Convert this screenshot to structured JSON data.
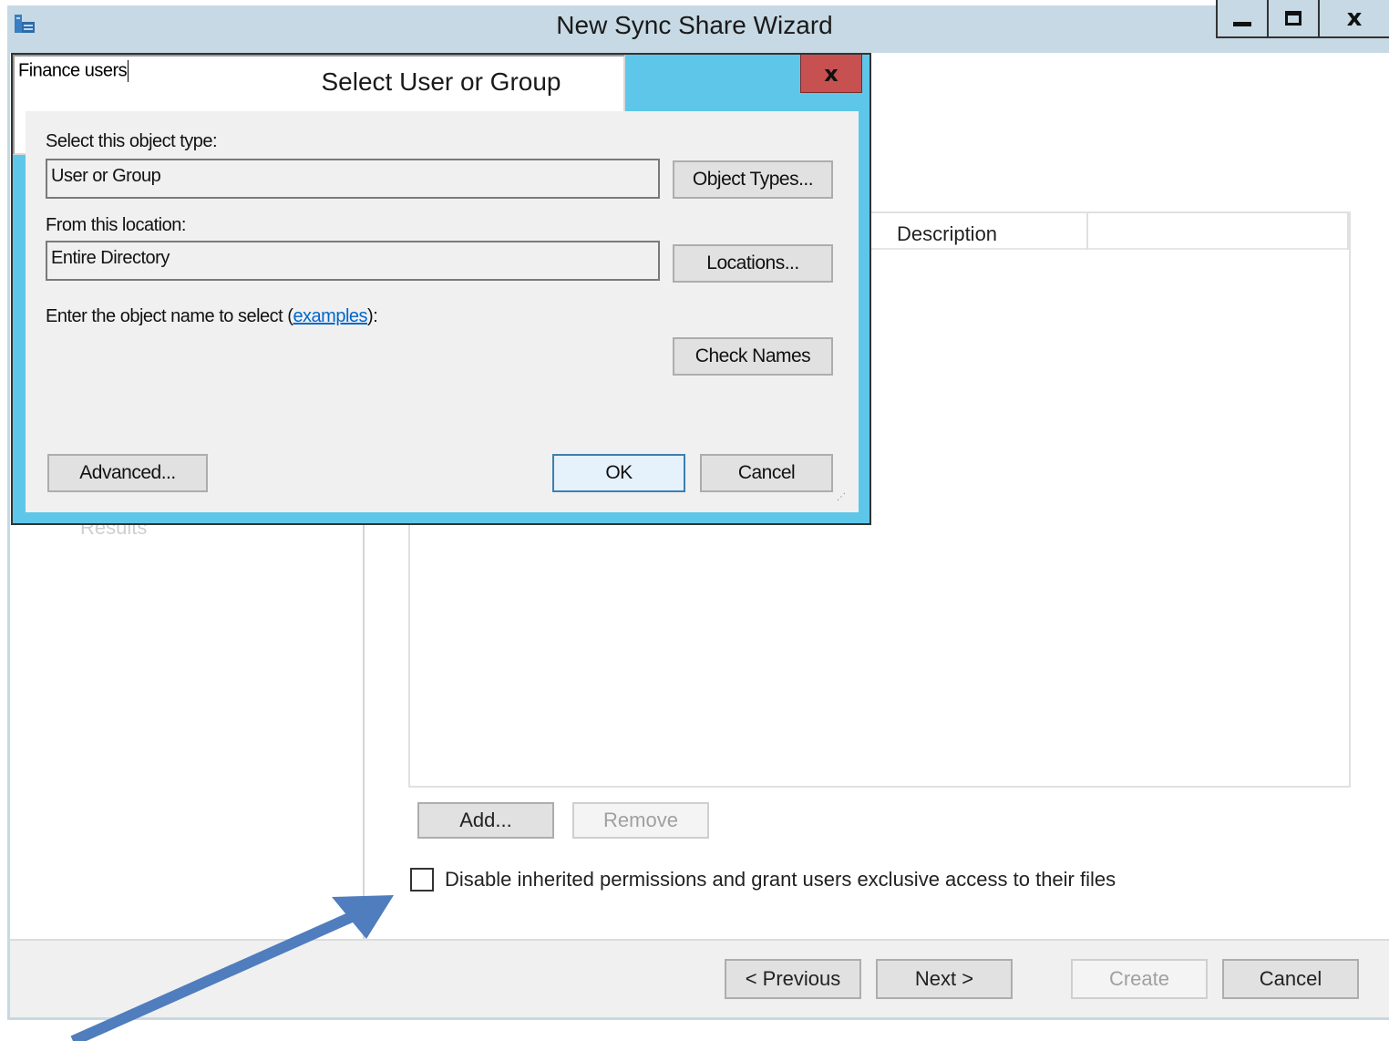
{
  "wizard": {
    "title": "New Sync Share Wizard",
    "window_controls": {
      "minimize": "minimize-icon",
      "maximize": "maximize-icon",
      "close": "x"
    },
    "steps": {
      "results": "Results"
    },
    "table": {
      "columns": [
        "",
        "Description",
        ""
      ]
    },
    "buttons": {
      "add": "Add...",
      "remove": "Remove",
      "previous": "< Previous",
      "next": "Next >",
      "create": "Create",
      "cancel": "Cancel"
    },
    "checkbox": {
      "label": "Disable inherited permissions and grant users exclusive access to their files",
      "checked": false
    }
  },
  "dialog": {
    "title": "Select User or Group",
    "close": "x",
    "object_type": {
      "label": "Select this object type:",
      "value": "User or Group",
      "button": "Object Types..."
    },
    "location": {
      "label": "From this location:",
      "value": "Entire Directory",
      "button": "Locations..."
    },
    "object_name": {
      "label_before": "Enter the object name to select (",
      "link": "examples",
      "label_after": "):",
      "value": "Finance users",
      "button": "Check Names"
    },
    "buttons": {
      "advanced": "Advanced...",
      "ok": "OK",
      "cancel": "Cancel"
    }
  },
  "colors": {
    "dialog_frame": "#5ec7e9",
    "close_button": "#c75050",
    "wizard_frame": "#c6d9e4",
    "annotation_arrow": "#4f7dbd",
    "link": "#0066cc"
  }
}
